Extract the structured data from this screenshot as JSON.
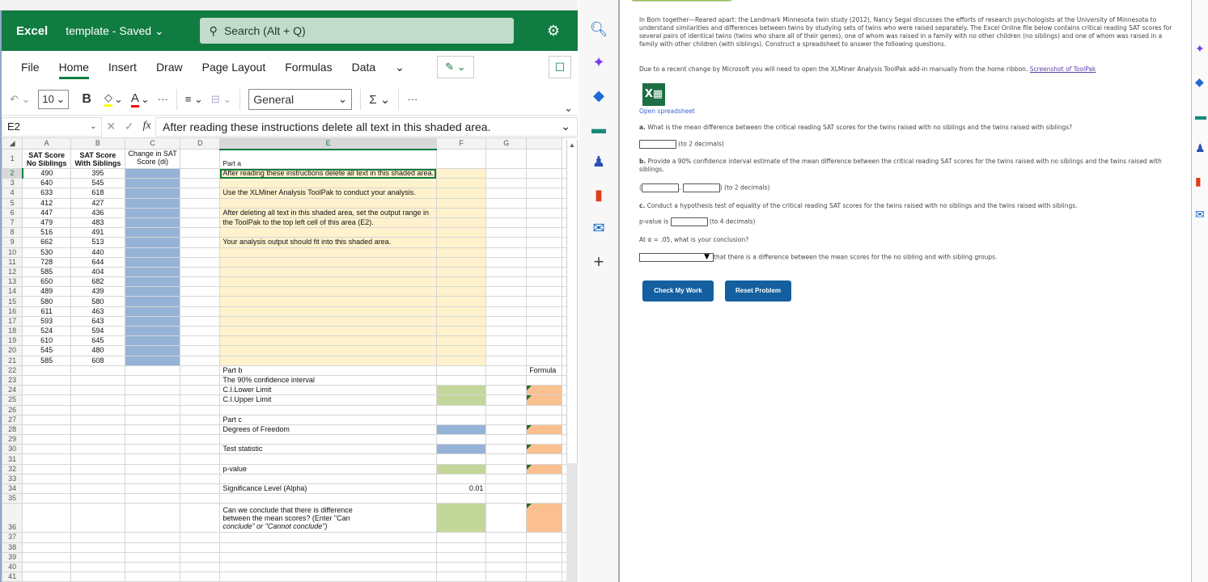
{
  "excel": {
    "app_name": "Excel",
    "doc_name": "template - Saved ⌄",
    "search_placeholder": "Search (Alt + Q)",
    "menu": [
      "File",
      "Home",
      "Insert",
      "Draw",
      "Page Layout",
      "Formulas",
      "Data",
      "⌄"
    ],
    "active_menu": "Home",
    "font_size": "10",
    "number_format": "General",
    "name_box": "E2",
    "formula": "After reading these instructions delete all text in this shaded area.",
    "columns": [
      "A",
      "B",
      "C",
      "D",
      "E",
      "F",
      "G"
    ],
    "headers": {
      "A": "SAT Score No Siblings",
      "B": "SAT Score With Siblings",
      "C": "Change in SAT Score (di)"
    },
    "rows": [
      {
        "a": "490",
        "b": "395"
      },
      {
        "a": "640",
        "b": "545"
      },
      {
        "a": "633",
        "b": "618"
      },
      {
        "a": "412",
        "b": "427"
      },
      {
        "a": "447",
        "b": "436"
      },
      {
        "a": "479",
        "b": "483"
      },
      {
        "a": "516",
        "b": "491"
      },
      {
        "a": "662",
        "b": "513"
      },
      {
        "a": "530",
        "b": "440"
      },
      {
        "a": "728",
        "b": "644"
      },
      {
        "a": "585",
        "b": "404"
      },
      {
        "a": "650",
        "b": "682"
      },
      {
        "a": "489",
        "b": "439"
      },
      {
        "a": "580",
        "b": "580"
      },
      {
        "a": "611",
        "b": "463"
      },
      {
        "a": "593",
        "b": "643"
      },
      {
        "a": "524",
        "b": "594"
      },
      {
        "a": "610",
        "b": "645"
      },
      {
        "a": "545",
        "b": "480"
      },
      {
        "a": "585",
        "b": "608"
      }
    ],
    "part_a": {
      "title": "Part a",
      "line1": "After reading these instructions delete all text in this shaded area.",
      "line2": "Use the XLMiner Analysis ToolPak to conduct your analysis.",
      "line3": "After deleting all text in this shaded area, set the output range in",
      "line4": "the ToolPak to the top left cell of this area (E2).",
      "line5": "Your analysis output should fit into this shaded area."
    },
    "formula_header": "Formula",
    "part_b": {
      "title": "Part b",
      "ci_label": "The 90% confidence interval",
      "lower": "C.I.Lower Limit",
      "upper": "C.I.Upper Limit"
    },
    "part_c": {
      "title": "Part c",
      "df": "Degrees of Freedom",
      "test_stat": "Test statistic",
      "p_value": "p-value",
      "alpha_label": "Significance Level (Alpha)",
      "alpha_value": "0.01",
      "conclude_1": "Can we conclude that there is difference",
      "conclude_2": "between the mean scores? (Enter \"Can",
      "conclude_3": "conclude\" or \"Cannot conclude\")"
    }
  },
  "panel": {
    "intro": "In Born together—Reared apart: the Landmark Minnesota twin study (2012), Nancy Segal discusses the efforts of research psychologists at the University of Minnesota to understand similarities and differences between twins by studying sets of twins who were raised separately. The Excel Online file below contains critical reading SAT scores for several pairs of identical twins (twins who share all of their genes), one of whom was raised in a family with no other children (no siblings) and one of whom was raised in a family with other children (with siblings). Construct a spreadsheet to answer the following questions.",
    "due": "Due to a recent change by Microsoft you will need to open the XLMiner Analysis ToolPak add-in manually from the home ribbon.",
    "toolpak_link": "Screenshot of ToolPak",
    "open_spreadsheet": "Open spreadsheet",
    "qa_label": "a.",
    "qa": "What is the mean difference between the critical reading SAT scores for the twins raised with no siblings and the twins raised with siblings?",
    "qa_hint": "(to 2 decimals)",
    "qb_label": "b.",
    "qb": "Provide a 90% confidence interval estimate of the mean difference between the critical reading SAT scores for the twins raised with no siblings and the twins raised with siblings.",
    "qb_hint": "(to 2 decimals)",
    "qc_label": "c.",
    "qc": "Conduct a hypothesis test of equality of the critical reading SAT scores for the twins raised with no siblings and the twins raised with siblings.",
    "pvalue_prefix": "p-value is",
    "pvalue_hint": "(to 4 decimals)",
    "alpha_q": "At α = .05, what is your conclusion?",
    "conclusion_tail": "that there is a difference between the mean scores for the no sibling and with sibling groups.",
    "check_btn": "Check My Work",
    "reset_btn": "Reset Problem"
  }
}
